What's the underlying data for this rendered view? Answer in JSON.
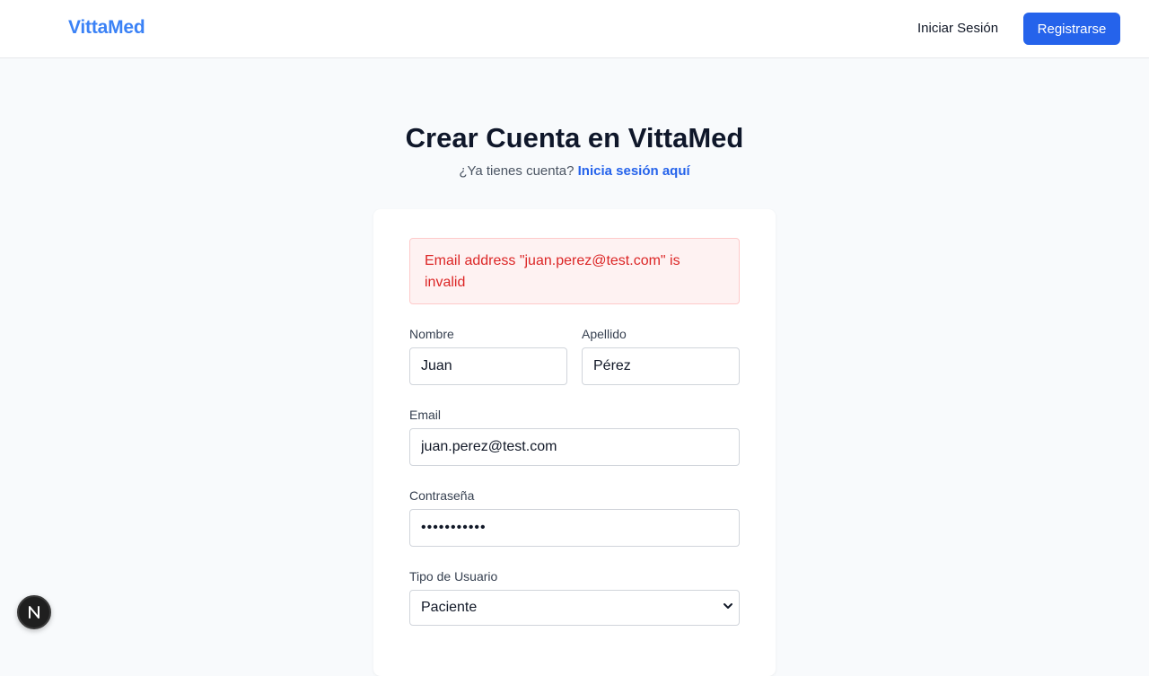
{
  "navbar": {
    "brand": "VittaMed",
    "login_label": "Iniciar Sesión",
    "register_label": "Registrarse"
  },
  "header": {
    "title": "Crear Cuenta en VittaMed",
    "subtitle_prefix": "¿Ya tienes cuenta? ",
    "subtitle_link": "Inicia sesión aquí"
  },
  "form": {
    "error_message": "Email address \"juan.perez@test.com\" is invalid",
    "first_name": {
      "label": "Nombre",
      "value": "Juan"
    },
    "last_name": {
      "label": "Apellido",
      "value": "Pérez"
    },
    "email": {
      "label": "Email",
      "value": "juan.perez@test.com"
    },
    "password": {
      "label": "Contraseña",
      "value": "•••••••••••"
    },
    "user_type": {
      "label": "Tipo de Usuario",
      "selected": "Paciente"
    }
  },
  "icons": {
    "next_badge": "nextjs-logo-icon",
    "select_chevron": "chevron-down-icon"
  },
  "colors": {
    "brand": "#3b82f6",
    "primary": "#2563eb",
    "error_text": "#dc2626",
    "error_bg": "#fef2f2"
  }
}
